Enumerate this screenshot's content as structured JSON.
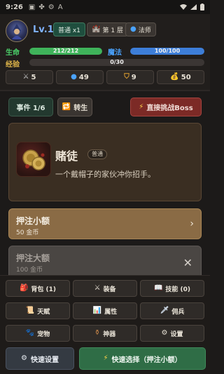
{
  "status_bar": {
    "time": "9:26",
    "icons": [
      "gallery-icon",
      "app-icon",
      "notification-icon",
      "a-icon"
    ]
  },
  "player": {
    "level": "Lv.1",
    "difficulty": "普通 x1",
    "floor": "第 1 层",
    "class": "法师"
  },
  "hp": {
    "label": "生命",
    "text": "212/212",
    "value": 212,
    "max": 212,
    "color": "#3fb35a"
  },
  "mp": {
    "label": "魔法",
    "text": "100/100",
    "value": 100,
    "max": 100,
    "color": "#3d7ed8"
  },
  "exp": {
    "label": "经验",
    "text": "0/30",
    "value": 0,
    "max": 30
  },
  "stats": [
    {
      "icon": "sword-icon",
      "value": "5"
    },
    {
      "icon": "gem-icon",
      "value": "49"
    },
    {
      "icon": "shield-icon",
      "value": "9"
    },
    {
      "icon": "money-bag-icon",
      "value": "50"
    }
  ],
  "event_bar": {
    "counter": "事件 1/6",
    "rebirth": "转生",
    "boss": "直接挑战Boss"
  },
  "event": {
    "title": "赌徒",
    "tag": "普通",
    "description": "一个戴帽子的家伙冲你招手。"
  },
  "options": [
    {
      "title": "押注小额",
      "subtitle": "50 金币"
    },
    {
      "title": "押注大额",
      "subtitle": "100 金币"
    }
  ],
  "menu": [
    {
      "icon": "backpack-icon",
      "label": "背包 (1)"
    },
    {
      "icon": "swords-icon",
      "label": "装备"
    },
    {
      "icon": "book-icon",
      "label": "技能 (0)"
    },
    {
      "icon": "scroll-icon",
      "label": "天赋"
    },
    {
      "icon": "chart-icon",
      "label": "属性"
    },
    {
      "icon": "dagger-icon",
      "label": "佣兵"
    },
    {
      "icon": "paw-icon",
      "label": "宠物"
    },
    {
      "icon": "urn-icon",
      "label": "神器"
    },
    {
      "icon": "gear-icon",
      "label": "设置"
    }
  ],
  "bottom": {
    "quick_settings": "快速设置",
    "quick_select": "快速选择（押注小额）"
  }
}
